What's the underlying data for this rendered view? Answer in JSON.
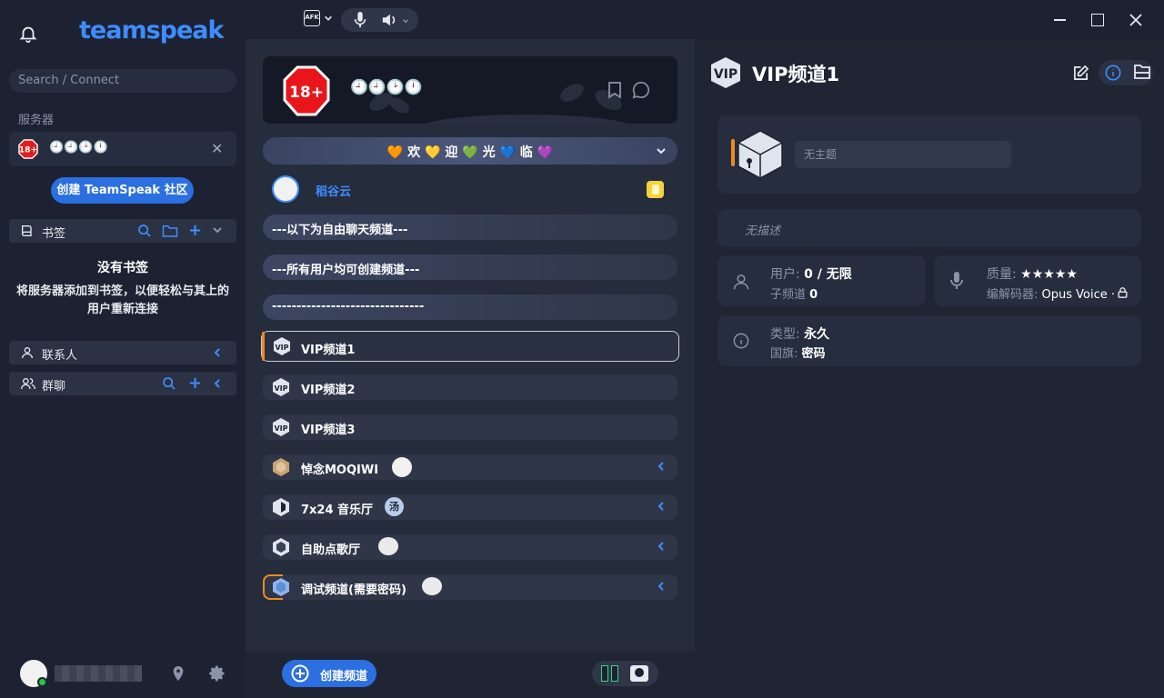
{
  "app": {
    "logo_text": "teamspeak"
  },
  "toolbar": {
    "afk_label": "AFK"
  },
  "sidebar": {
    "search_placeholder": "Search / Connect",
    "servers_label": "服务器",
    "server_name": "🕘🕘🕑🕛",
    "create_community": "创建 TeamSpeak 社区",
    "bookmarks_label": "书签",
    "no_bookmarks_title": "没有书签",
    "no_bookmarks_hint": "将服务器添加到书签，以便轻松与其上的用户重新连接",
    "contacts_label": "联系人",
    "group_chat_label": "群聊"
  },
  "middle": {
    "server_badge": "18+",
    "server_title": "🕘🕘🕑🕛",
    "welcome": "🧡 欢 💛 迎 💚 光 💙 临 💜",
    "user_name": "稻谷云",
    "channels": [
      {
        "name": "---以下为自由聊天频道---",
        "type": "spacer"
      },
      {
        "name": "---所有用户均可创建频道---",
        "type": "spacer"
      },
      {
        "name": "-------------------------------",
        "type": "spacer"
      },
      {
        "name": "VIP频道1",
        "type": "vip",
        "selected": true
      },
      {
        "name": "VIP频道2",
        "type": "vip"
      },
      {
        "name": "VIP频道3",
        "type": "vip"
      },
      {
        "name": "悼念MOQIWI",
        "type": "gold",
        "expandable": true
      },
      {
        "name": "7x24 音乐厅",
        "type": "dark",
        "expandable": true,
        "badge": "汤"
      },
      {
        "name": "自助点歌厅",
        "type": "dark",
        "expandable": true
      },
      {
        "name": "调试频道(需要密码)",
        "type": "blue",
        "expandable": true
      }
    ],
    "create_channel": "创建频道"
  },
  "right": {
    "channel_icon_text": "VIP",
    "channel_title": "VIP频道1",
    "topic_placeholder": "无主题",
    "description_placeholder": "无描述",
    "users_label": "用户:",
    "users_value": "0 / 无限",
    "subchannels_label": "子频道",
    "subchannels_value": "0",
    "quality_label": "质量:",
    "quality_value": "★★★★★",
    "codec_label": "编解码器:",
    "codec_value": "Opus Voice ·",
    "type_label": "类型:",
    "type_value": "永久",
    "flag_label": "国旗:",
    "flag_value": "密码"
  },
  "colors": {
    "accent": "#2b6fe0",
    "link": "#3f8cff",
    "bg": "#1c2231"
  }
}
